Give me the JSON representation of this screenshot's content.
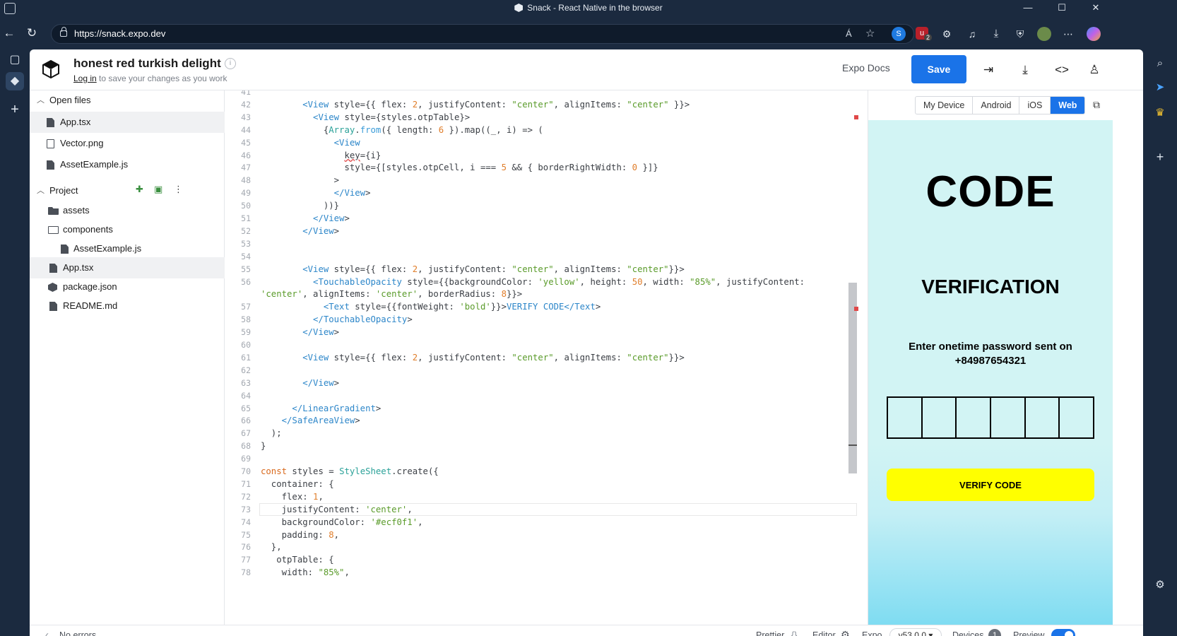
{
  "browser": {
    "window_title": "Snack - React Native in the browser",
    "url": "https://snack.expo.dev",
    "read_aloud": "Á",
    "extension_badge": "2"
  },
  "header": {
    "project_title": "honest red turkish delight",
    "info": "i",
    "login": "Log in",
    "login_suffix": " to save your changes as you work",
    "docs": "Expo Docs",
    "save": "Save"
  },
  "sidebar": {
    "open_files_label": "Open files",
    "open_files": [
      "App.tsx",
      "Vector.png",
      "AssetExample.js"
    ],
    "project_label": "Project",
    "project_items": [
      "assets",
      "components",
      "AssetExample.js",
      "App.tsx",
      "package.json",
      "README.md"
    ]
  },
  "editor": {
    "line_numbers": [
      "41",
      "42",
      "43",
      "44",
      "45",
      "46",
      "47",
      "48",
      "49",
      "50",
      "51",
      "52",
      "53",
      "54",
      "55",
      "56",
      "",
      "57",
      "58",
      "59",
      "60",
      "61",
      "62",
      "63",
      "64",
      "65",
      "66",
      "67",
      "68",
      "69",
      "70",
      "71",
      "72",
      "73",
      "74",
      "75",
      "76",
      "77",
      "78"
    ]
  },
  "preview": {
    "tabs": [
      "My Device",
      "Android",
      "iOS",
      "Web"
    ],
    "active_tab": "Web",
    "app": {
      "title": "CODE",
      "subtitle": "VERIFICATION",
      "message": "Enter onetime password sent on +84987654321",
      "otp_cells": 6,
      "button": "VERIFY CODE"
    }
  },
  "footer": {
    "errors": "No errors",
    "prettier": "Prettier",
    "prettier_icon": "{}",
    "editor": "Editor",
    "expo": "Expo",
    "expo_version": "v53.0.0 ▾",
    "devices": "Devices",
    "device_count": "1",
    "preview": "Preview"
  },
  "colors": {
    "accent": "#1a73e8",
    "button_yellow": "#ffff00",
    "phone_bg": "#d2f4f4"
  }
}
